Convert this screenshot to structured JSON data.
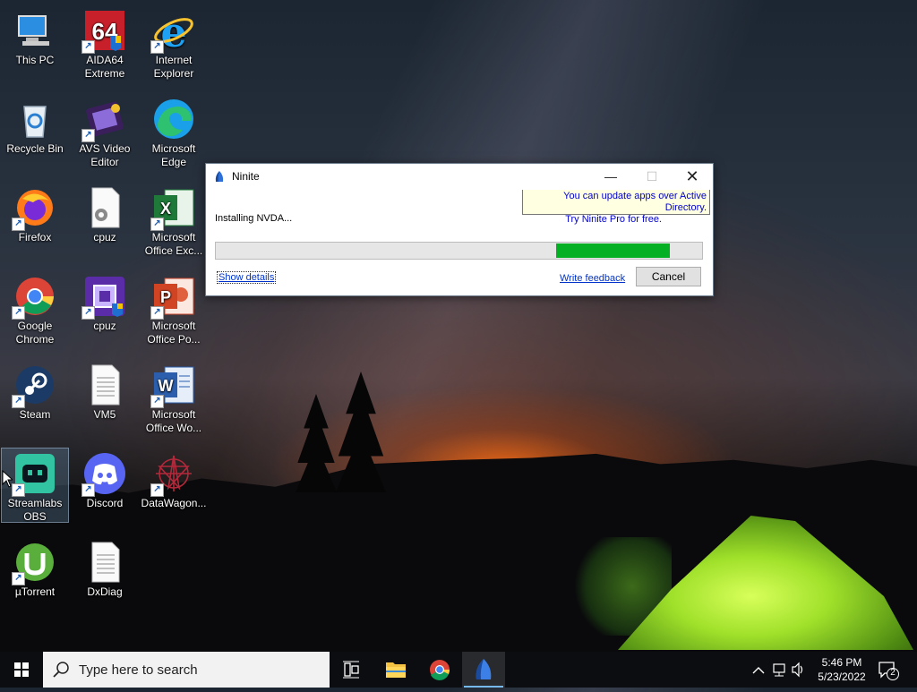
{
  "desktop": {
    "icons": [
      {
        "label": "This PC"
      },
      {
        "label": "AIDA64 Extreme"
      },
      {
        "label": "Internet Explorer"
      },
      {
        "label": "Recycle Bin"
      },
      {
        "label": "AVS Video Editor"
      },
      {
        "label": "Microsoft Edge"
      },
      {
        "label": "Firefox"
      },
      {
        "label": "cpuz"
      },
      {
        "label": "Microsoft Office Exc..."
      },
      {
        "label": "Google Chrome"
      },
      {
        "label": "cpuz"
      },
      {
        "label": "Microsoft Office Po..."
      },
      {
        "label": "Steam"
      },
      {
        "label": "VM5"
      },
      {
        "label": "Microsoft Office Wo..."
      },
      {
        "label": "Streamlabs OBS"
      },
      {
        "label": "Discord"
      },
      {
        "label": "DataWagon..."
      },
      {
        "label": "µTorrent"
      },
      {
        "label": "DxDiag"
      }
    ]
  },
  "ninite": {
    "title": "Ninite",
    "minimize": "—",
    "maximize": "☐",
    "close": "✕",
    "ad_line1": "You can update apps over Active Directory.",
    "ad_line2": "Try Ninite Pro for free.",
    "status": "Installing NVDA...",
    "progress_fraction_start": 0.7,
    "progress_fraction_end": 0.934,
    "show_details": "Show details",
    "write_feedback": "Write feedback",
    "cancel": "Cancel"
  },
  "taskbar": {
    "search_placeholder": "Type here to search",
    "time": "5:46 PM",
    "date": "5/23/2022",
    "notification_count": "2"
  },
  "colors": {
    "progress_green": "#06b025",
    "taskbar_bg": "#0c0d10",
    "link_blue": "#0033cc"
  }
}
